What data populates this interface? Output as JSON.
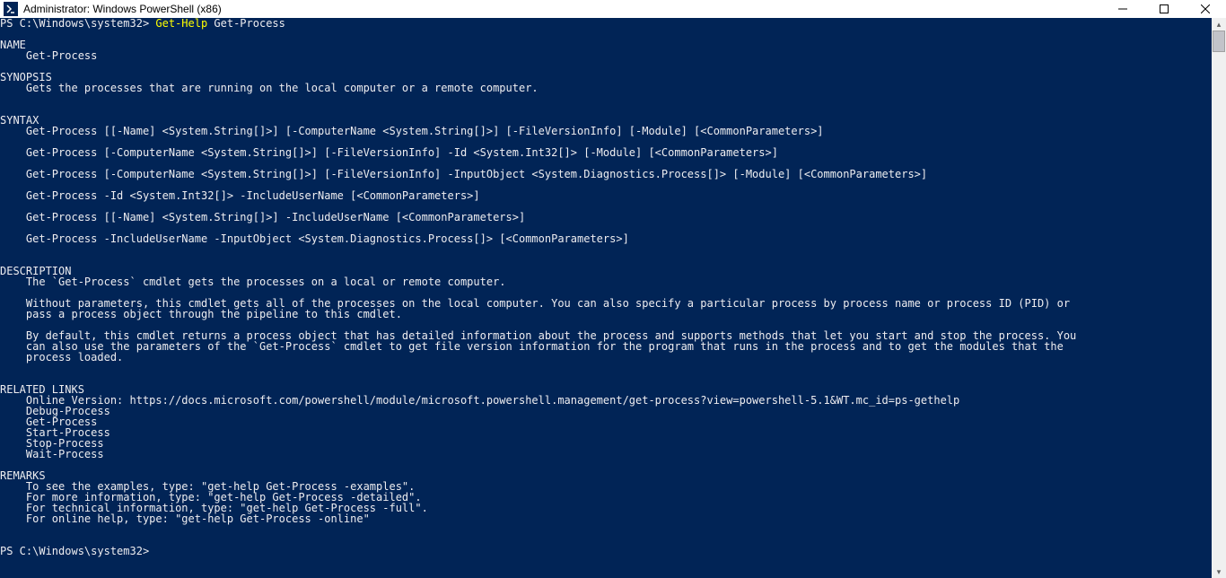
{
  "window": {
    "title": "Administrator: Windows PowerShell (x86)"
  },
  "prompt": {
    "prefix": "PS C:\\Windows\\system32> ",
    "cmd_part1": "Get-Help",
    "cmd_part2": " Get-Process"
  },
  "prompt2": {
    "text": "PS C:\\Windows\\system32> "
  },
  "sections": {
    "name_heading": "NAME",
    "name_value": "    Get-Process",
    "synopsis_heading": "SYNOPSIS",
    "synopsis_value": "    Gets the processes that are running on the local computer or a remote computer.",
    "syntax_heading": "SYNTAX",
    "syntax_lines": [
      "    Get-Process [[-Name] <System.String[]>] [-ComputerName <System.String[]>] [-FileVersionInfo] [-Module] [<CommonParameters>]",
      "",
      "    Get-Process [-ComputerName <System.String[]>] [-FileVersionInfo] -Id <System.Int32[]> [-Module] [<CommonParameters>]",
      "",
      "    Get-Process [-ComputerName <System.String[]>] [-FileVersionInfo] -InputObject <System.Diagnostics.Process[]> [-Module] [<CommonParameters>]",
      "",
      "    Get-Process -Id <System.Int32[]> -IncludeUserName [<CommonParameters>]",
      "",
      "    Get-Process [[-Name] <System.String[]>] -IncludeUserName [<CommonParameters>]",
      "",
      "    Get-Process -IncludeUserName -InputObject <System.Diagnostics.Process[]> [<CommonParameters>]"
    ],
    "description_heading": "DESCRIPTION",
    "description_lines": [
      "    The `Get-Process` cmdlet gets the processes on a local or remote computer.",
      "",
      "    Without parameters, this cmdlet gets all of the processes on the local computer. You can also specify a particular process by process name or process ID (PID) or",
      "    pass a process object through the pipeline to this cmdlet.",
      "",
      "    By default, this cmdlet returns a process object that has detailed information about the process and supports methods that let you start and stop the process. You",
      "    can also use the parameters of the `Get-Process` cmdlet to get file version information for the program that runs in the process and to get the modules that the",
      "    process loaded."
    ],
    "related_heading": "RELATED LINKS",
    "related_lines": [
      "    Online Version: https://docs.microsoft.com/powershell/module/microsoft.powershell.management/get-process?view=powershell-5.1&WT.mc_id=ps-gethelp",
      "    Debug-Process",
      "    Get-Process",
      "    Start-Process",
      "    Stop-Process",
      "    Wait-Process"
    ],
    "remarks_heading": "REMARKS",
    "remarks_lines": [
      "    To see the examples, type: \"get-help Get-Process -examples\".",
      "    For more information, type: \"get-help Get-Process -detailed\".",
      "    For technical information, type: \"get-help Get-Process -full\".",
      "    For online help, type: \"get-help Get-Process -online\""
    ]
  }
}
